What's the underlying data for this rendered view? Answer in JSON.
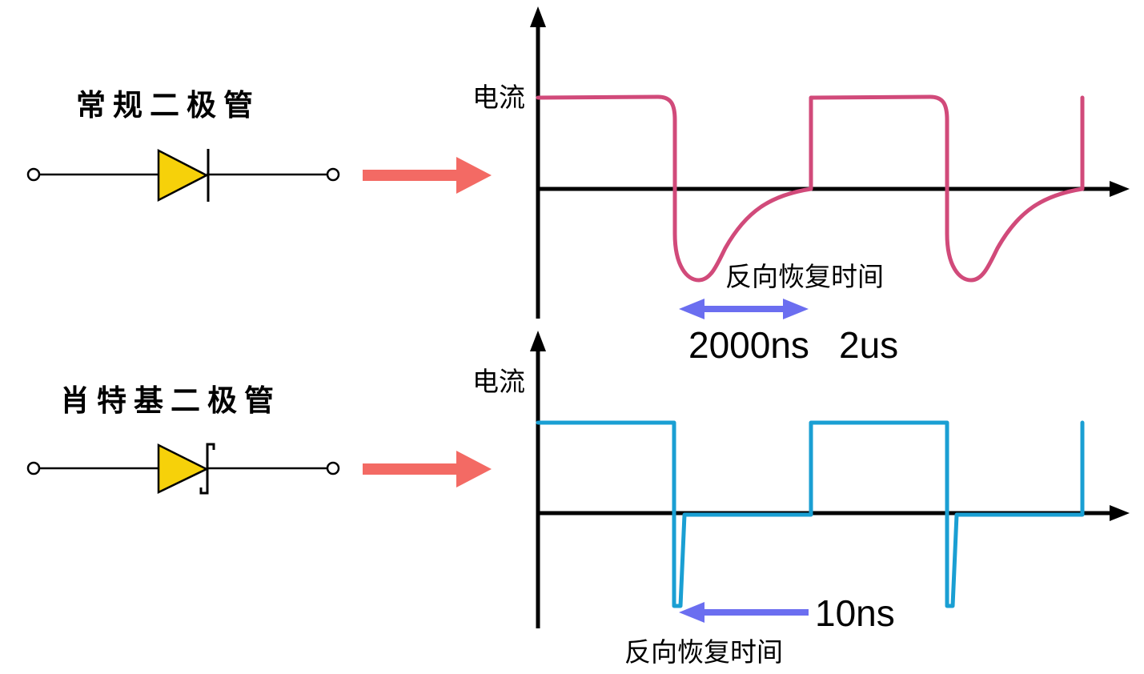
{
  "regular_diode": {
    "label": "常规二极管"
  },
  "schottky_diode": {
    "label": "肖特基二极管"
  },
  "top_graph": {
    "y_label": "电流",
    "annotation": "反向恢复时间",
    "time_ns": "2000ns",
    "time_us": "2us"
  },
  "bottom_graph": {
    "y_label": "电流",
    "annotation": "反向恢复时间",
    "time_ns": "10ns"
  },
  "colors": {
    "regular_wave": "#d14a7a",
    "schottky_wave": "#1a9fd3",
    "flow_arrow": "#f36a64",
    "time_arrow": "#6b6ef0",
    "diode_fill": "#f6d10a"
  }
}
